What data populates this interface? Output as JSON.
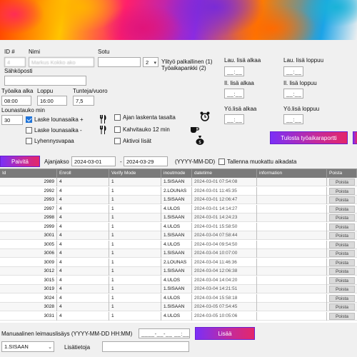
{
  "banner": {},
  "employee": {
    "id_label": "ID #",
    "id_value": "4",
    "name_label": "Nimi",
    "name_value": "Markus Kokko ako",
    "sotu_label": "Sotu",
    "sotu_value": "",
    "select_value": "2",
    "overtime_text_1": "Ylityö palkallinen (1)",
    "overtime_text_2": "Työaikapankki (2)",
    "email_label": "Sähköposti",
    "email_value": ""
  },
  "schedule": {
    "start_label": "Työaika alka",
    "start_value": "08:00",
    "end_label": "Loppu",
    "end_value": "16:00",
    "hours_label": "Tunteja/vuoro",
    "hours_value": "7,5",
    "lunch_label": "Lounastauko min",
    "lunch_value": "30"
  },
  "options": {
    "lunch_plus": "Laske lounasaika +",
    "lunch_minus": "Laske lounasaika -",
    "shortened": "Lyhennysvapaa",
    "clock_time": "Ajan laskenta tasalta",
    "coffee": "Kahvitauko 12 min",
    "extra": "Aktivoi lisät"
  },
  "icons": {
    "cutlery": "cutlery-icon",
    "alarm": "alarm-clock-icon",
    "coffee": "coffee-cup-icon",
    "moneybag": "money-bag-icon"
  },
  "additions": {
    "sat_start": "Lau. lisä alkaa",
    "sat_end": "Lau. lisä loppuu",
    "eve_start": "Il. lisä alkaa",
    "eve_end": "Il. lisä loppuu",
    "night_start": "Yö.lisä alkaa",
    "night_end": "Yö.lisä loppuu",
    "time_mask": "__:__"
  },
  "report_button": "Tulosta työaikaraportti",
  "filter": {
    "refresh_button": "Paivitä",
    "period_label": "Ajanjakso",
    "from": "2024-03-01",
    "dash": "-",
    "to": "2024-03-29",
    "format_hint": "(YYYY-MM-DD)",
    "save_label": "Tallenna muokattu aikadata"
  },
  "grid": {
    "columns": [
      "Id",
      "Enroll",
      "Verify Mode",
      "inoutmode",
      "datetime",
      "information",
      "Poista"
    ],
    "delete_label": "Poista",
    "rows": [
      [
        "2989",
        "4",
        "1",
        "1.SISAAN",
        "2024-03-01 07:54:08",
        ""
      ],
      [
        "2992",
        "4",
        "1",
        "2.LOUNAS",
        "2024-03-01 11:45:35",
        ""
      ],
      [
        "2993",
        "4",
        "1",
        "1.SISAAN",
        "2024-03-01 12:06:47",
        ""
      ],
      [
        "2997",
        "4",
        "1",
        "4.ULOS",
        "2024-03-01 14:14:27",
        ""
      ],
      [
        "2998",
        "4",
        "1",
        "1.SISAAN",
        "2024-03-01 14:24:23",
        ""
      ],
      [
        "2999",
        "4",
        "1",
        "4.ULOS",
        "2024-03-01 15:58:50",
        ""
      ],
      [
        "3001",
        "4",
        "1",
        "1.SISAAN",
        "2024-03-04 07:58:44",
        ""
      ],
      [
        "3005",
        "4",
        "1",
        "4.ULOS",
        "2024-03-04 09:54:50",
        ""
      ],
      [
        "3006",
        "4",
        "1",
        "1.SISAAN",
        "2024-03-04 10:07:00",
        ""
      ],
      [
        "3009",
        "4",
        "1",
        "2.LOUNAS",
        "2024-03-04 11:46:36",
        ""
      ],
      [
        "3012",
        "4",
        "1",
        "1.SISAAN",
        "2024-03-04 12:06:38",
        ""
      ],
      [
        "3015",
        "4",
        "1",
        "4.ULOS",
        "2024-03-04 14:04:20",
        ""
      ],
      [
        "3019",
        "4",
        "1",
        "1.SISAAN",
        "2024-03-04 14:21:51",
        ""
      ],
      [
        "3024",
        "4",
        "1",
        "4.ULOS",
        "2024-03-04 15:58:18",
        ""
      ],
      [
        "3028",
        "4",
        "1",
        "1.SISAAN",
        "2024-03-05 07:54:45",
        ""
      ],
      [
        "3031",
        "4",
        "1",
        "4.ULOS",
        "2024-03-05 10:05:06",
        ""
      ]
    ]
  },
  "manual": {
    "label": "Manuaalinen leimauslisäys (YYYY-MM-DD HH:MM)",
    "mask": "____-__-__ __:__",
    "add_button": "Lisää",
    "mode_value": "1.SISAAN",
    "extra_label": "Lisätietoja",
    "extra_value": ""
  }
}
